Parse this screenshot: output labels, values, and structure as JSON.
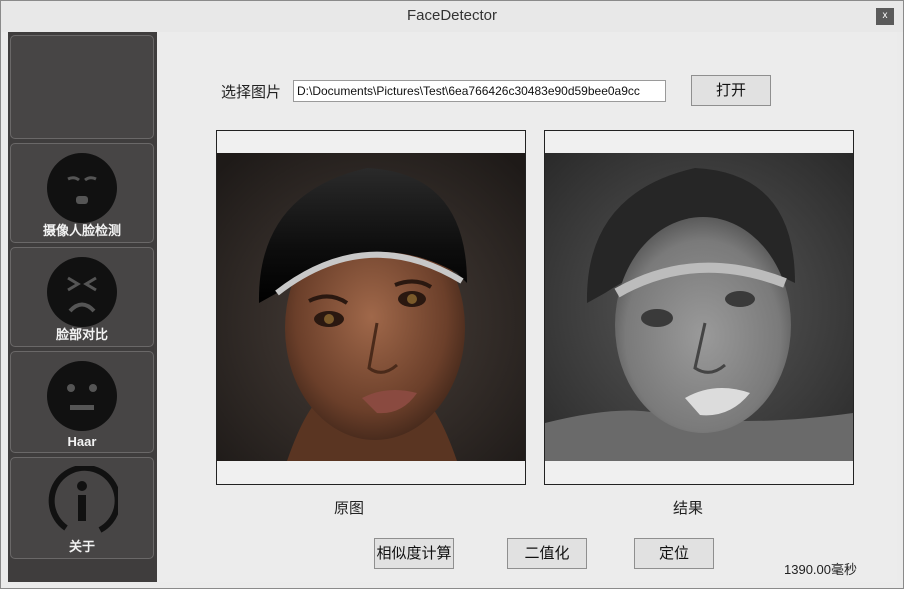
{
  "window": {
    "title": "FaceDetector",
    "close": "x"
  },
  "sidebar": {
    "items": [
      {
        "label": ""
      },
      {
        "label": "摄像人脸检测"
      },
      {
        "label": "脸部对比"
      },
      {
        "label": "Haar"
      },
      {
        "label": "关于"
      }
    ]
  },
  "main": {
    "select_label": "选择图片",
    "path_value": "D:\\Documents\\Pictures\\Test\\6ea766426c30483e90d59bee0a9cc",
    "open_button": "打开",
    "original_caption": "原图",
    "result_caption": "结果",
    "similarity_button": "相似度计算",
    "binarize_button": "二值化",
    "locate_button": "定位",
    "timing": "1390.00毫秒"
  }
}
